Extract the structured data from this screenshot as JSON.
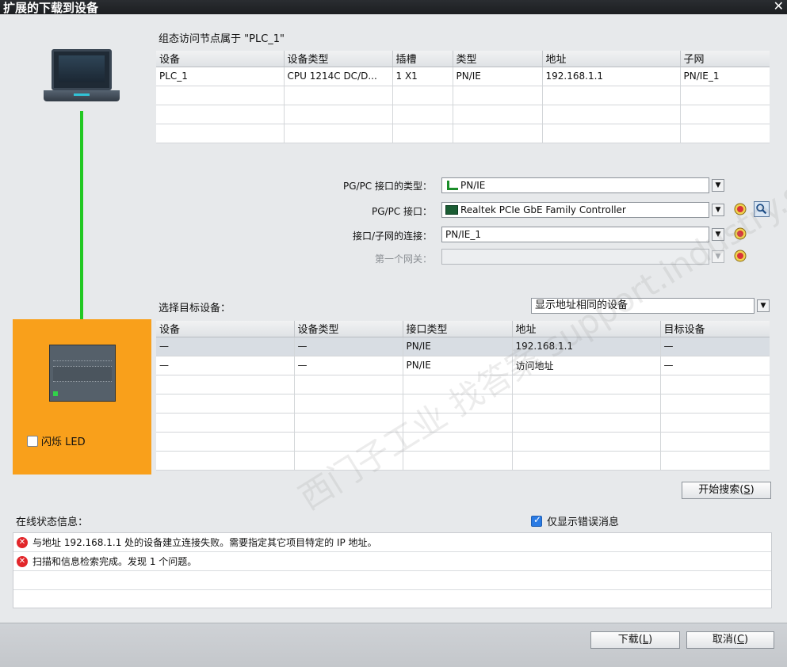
{
  "window": {
    "title": "扩展的下载到设备",
    "close": "✕"
  },
  "config_caption": "组态访问节点属于 \"PLC_1\"",
  "config_table": {
    "headers": [
      "设备",
      "设备类型",
      "插槽",
      "类型",
      "地址",
      "子网"
    ],
    "rows": [
      [
        "PLC_1",
        "CPU 1214C DC/D...",
        "1 X1",
        "PN/IE",
        "192.168.1.1",
        "PN/IE_1"
      ]
    ]
  },
  "form": {
    "iface_type_label": "PG/PC 接口的类型：",
    "iface_type_value": "PN/IE",
    "iface_label": "PG/PC 接口：",
    "iface_value": "Realtek PCIe GbE Family Controller",
    "subnet_label": "接口/子网的连接：",
    "subnet_value": "PN/IE_1",
    "gateway_label": "第一个网关："
  },
  "target": {
    "caption": "选择目标设备：",
    "filter": "显示地址相同的设备",
    "headers": [
      "设备",
      "设备类型",
      "接口类型",
      "地址",
      "目标设备"
    ],
    "rows": [
      [
        "—",
        "—",
        "PN/IE",
        "192.168.1.1",
        "—"
      ],
      [
        "—",
        "—",
        "PN/IE",
        "访问地址",
        "—"
      ]
    ]
  },
  "flash_led": "闪烁 LED",
  "search_button": {
    "label": "开始搜索(",
    "key": "S",
    "end": ")"
  },
  "status": {
    "label": "在线状态信息：",
    "only_errors": "仅显示错误消息",
    "messages": [
      "与地址 192.168.1.1 处的设备建立连接失败。需要指定其它项目特定的 IP 地址。",
      "扫描和信息检索完成。发现 1 个问题。"
    ]
  },
  "footer": {
    "download": {
      "label": "下载(",
      "key": "L",
      "end": ")"
    },
    "cancel": {
      "label": "取消(",
      "key": "C",
      "end": ")"
    }
  },
  "watermark": "西门子工业 找答案 support.industry.siemens.com/cs"
}
